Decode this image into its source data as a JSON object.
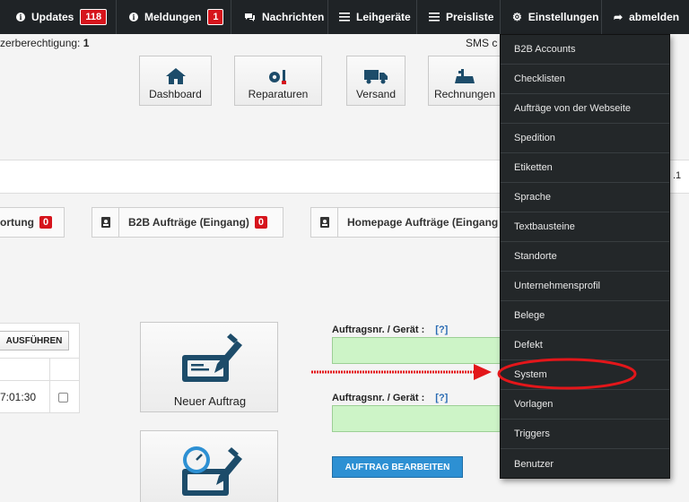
{
  "nav": {
    "updates": {
      "label": "Updates",
      "count": "118"
    },
    "meldungen": {
      "label": "Meldungen",
      "count": "1"
    },
    "nachrichten": "Nachrichten",
    "leihgeraete": "Leihgeräte",
    "preisliste": "Preisliste",
    "einstellungen": "Einstellungen",
    "abmelden": "abmelden"
  },
  "subheader": {
    "permission_label": "zerberechtigung:",
    "permission_value": "1",
    "sms_text": "SMS c"
  },
  "tiles": [
    "Dashboard",
    "Reparaturen",
    "Versand",
    "Rechnungen"
  ],
  "band_number": ".1",
  "tabs": [
    {
      "label": "ortung",
      "count": "0"
    },
    {
      "label": "B2B Aufträge (Eingang)",
      "count": "0"
    },
    {
      "label": "Homepage Aufträge (Eingang"
    }
  ],
  "table": {
    "execute_button": "AUSFÜHREN",
    "time_cell": "7:01:30"
  },
  "actions": {
    "new_order": "Neuer Auftrag"
  },
  "form": {
    "label1": "Auftragsnr. / Gerät :",
    "help1": "[?]",
    "label2": "Auftragsnr. / Gerät :",
    "help2": "[?]",
    "edit_button": "AUFTRAG BEARBEITEN"
  },
  "dropdown": [
    "B2B Accounts",
    "Checklisten",
    "Aufträge von der Webseite",
    "Spedition",
    "Etiketten",
    "Sprache",
    "Textbausteine",
    "Standorte",
    "Unternehmensprofil",
    "Belege",
    "Defekt",
    "System",
    "Vorlagen",
    "Triggers",
    "Benutzer"
  ],
  "colors": {
    "topbar": "#1f2326",
    "badge": "#d6141c",
    "input_green": "#cdf4c7",
    "button_blue": "#2d90d3",
    "annotation_red": "#e3161a"
  }
}
